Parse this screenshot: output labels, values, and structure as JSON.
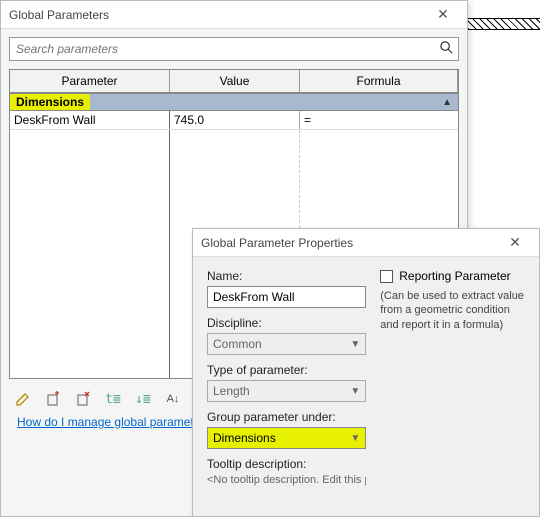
{
  "gp": {
    "title": "Global Parameters",
    "search_placeholder": "Search parameters",
    "cols": {
      "parameter": "Parameter",
      "value": "Value",
      "formula": "Formula"
    },
    "group": "Dimensions",
    "row": {
      "name": "DeskFrom Wall",
      "value": "745.0",
      "formula": "="
    },
    "help": "How do I manage global parameters?"
  },
  "props": {
    "title": "Global Parameter Properties",
    "name_label": "Name:",
    "name_value": "DeskFrom Wall",
    "discipline_label": "Discipline:",
    "discipline_value": "Common",
    "type_label": "Type of parameter:",
    "type_value": "Length",
    "group_label": "Group parameter under:",
    "group_value": "Dimensions",
    "tooltip_label": "Tooltip description:",
    "tooltip_value": "<No tooltip description. Edit this parameter to write a custom toolti",
    "reporting_label": "Reporting Parameter",
    "reporting_hint": "(Can be used to extract value from a geometric condition and report it in a formula)"
  }
}
